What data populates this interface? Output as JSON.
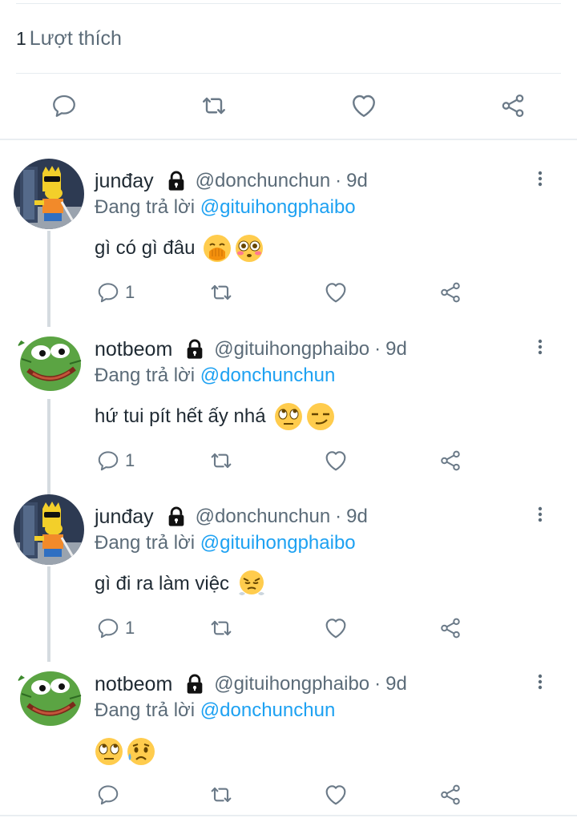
{
  "tweet": {
    "likes_count": "1",
    "likes_label": "Lượt thích",
    "actions": [
      "reply",
      "retweet",
      "like",
      "share"
    ]
  },
  "replying_label": "Đang trả lời",
  "replies": [
    {
      "name": "junđay",
      "handle": "@donchunchun",
      "separator": "·",
      "time": "9d",
      "replying_to": "@gituihongphaibo",
      "text": "gì có gì đâu",
      "emojis": [
        "hand-over-mouth-emoji",
        "flushed-face-emoji"
      ],
      "reply_count": "1",
      "avatar": "bart-avatar"
    },
    {
      "name": "notbeom",
      "handle": "@gituihongphaibo",
      "separator": "·",
      "time": "9d",
      "replying_to": "@donchunchun",
      "text": "hứ tui pít hết ấy nhá",
      "emojis": [
        "eye-roll-emoji",
        "smirk-emoji"
      ],
      "reply_count": "1",
      "avatar": "pepe-avatar"
    },
    {
      "name": "junđay",
      "handle": "@donchunchun",
      "separator": "·",
      "time": "9d",
      "replying_to": "@gituihongphaibo",
      "text": "gì đi ra làm việc",
      "emojis": [
        "steam-from-nose-emoji"
      ],
      "reply_count": "1",
      "avatar": "bart-avatar"
    },
    {
      "name": "notbeom",
      "handle": "@gituihongphaibo",
      "separator": "·",
      "time": "9d",
      "replying_to": "@donchunchun",
      "text": "",
      "emojis": [
        "eye-roll-emoji",
        "sad-sweat-emoji"
      ],
      "reply_count": "",
      "avatar": "pepe-avatar"
    }
  ],
  "colors": {
    "link": "#1da1f2",
    "muted": "#5b6b78",
    "icon": "#6b7a88",
    "divider": "#e6ecf0"
  }
}
